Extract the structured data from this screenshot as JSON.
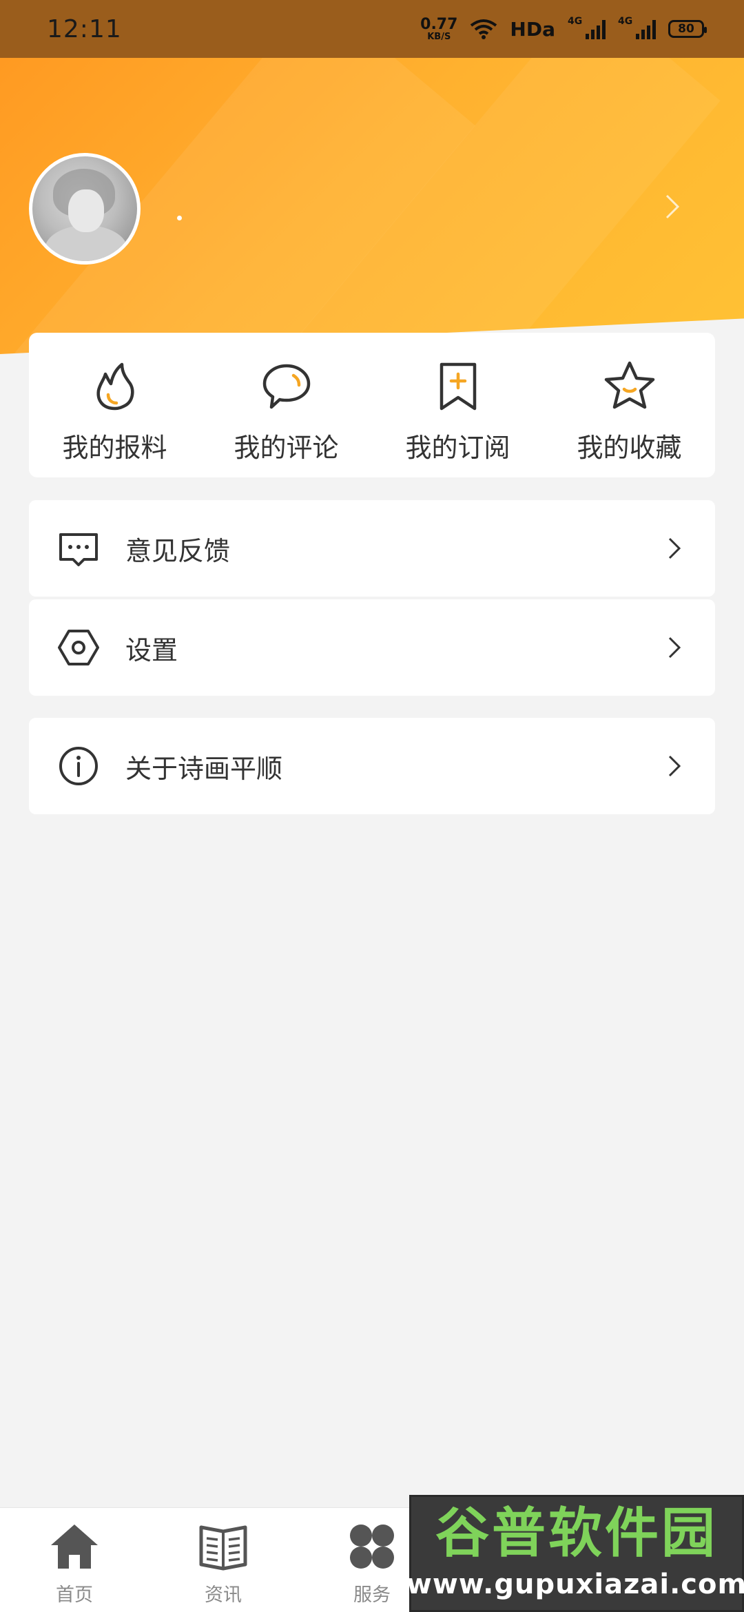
{
  "status_bar": {
    "time": "12:11",
    "net_speed_value": "0.77",
    "net_speed_unit": "KB/S",
    "hd": "HDa",
    "sim1": "4G",
    "sim2": "4G",
    "battery": "80"
  },
  "profile": {
    "username": "."
  },
  "quick_actions": [
    {
      "label": "我的报料",
      "icon": "flame-icon"
    },
    {
      "label": "我的评论",
      "icon": "speech-bubble-icon"
    },
    {
      "label": "我的订阅",
      "icon": "bookmark-plus-icon"
    },
    {
      "label": "我的收藏",
      "icon": "star-icon"
    }
  ],
  "menu": {
    "feedback": {
      "label": "意见反馈",
      "icon": "feedback-message-icon"
    },
    "settings": {
      "label": "设置",
      "icon": "hex-nut-icon"
    },
    "about": {
      "label": "关于诗画平顺",
      "icon": "info-circle-icon"
    }
  },
  "bottom_nav": [
    {
      "label": "首页",
      "icon": "home-icon"
    },
    {
      "label": "资讯",
      "icon": "newspaper-icon"
    },
    {
      "label": "服务",
      "icon": "clover-grid-icon"
    }
  ],
  "watermark": {
    "title": "谷普软件园",
    "url": "www.gupuxiazai.com"
  },
  "colors": {
    "header_orange": "#ff9a22",
    "header_yellow": "#ffc235",
    "accent_orange": "#f5a623",
    "icon_dark": "#333333",
    "background": "#f3f3f3"
  }
}
